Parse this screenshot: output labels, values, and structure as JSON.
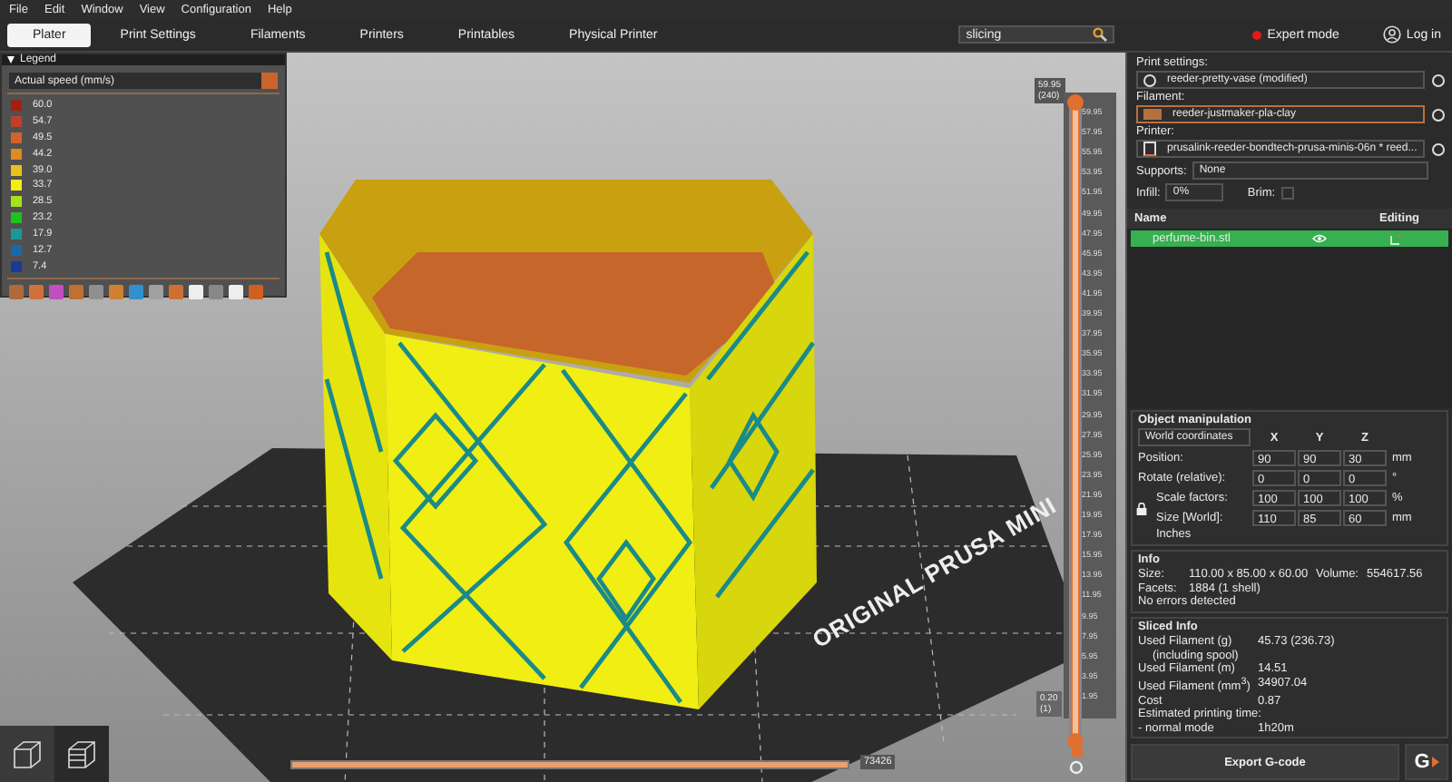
{
  "menu": [
    "File",
    "Edit",
    "Window",
    "View",
    "Configuration",
    "Help"
  ],
  "tabs": [
    {
      "label": "Plater",
      "selected": true
    },
    {
      "label": "Print Settings",
      "selected": false
    },
    {
      "label": "Filaments",
      "selected": false
    },
    {
      "label": "Printers",
      "selected": false
    },
    {
      "label": "Printables",
      "selected": false
    },
    {
      "label": "Physical Printer",
      "selected": false
    }
  ],
  "search": {
    "value": "slicing"
  },
  "mode": {
    "label": "Expert mode"
  },
  "login": {
    "label": "Log in"
  },
  "legend": {
    "title": "Legend",
    "view_type": "Actual speed (mm/s)",
    "items": [
      {
        "label": "60.0",
        "color": "#a3200f"
      },
      {
        "label": "54.7",
        "color": "#c23e2a"
      },
      {
        "label": "49.5",
        "color": "#d4622c"
      },
      {
        "label": "44.2",
        "color": "#e08a20"
      },
      {
        "label": "39.0",
        "color": "#e8c21c"
      },
      {
        "label": "33.7",
        "color": "#f2ee12"
      },
      {
        "label": "28.5",
        "color": "#a6e21a"
      },
      {
        "label": "23.2",
        "color": "#20c020"
      },
      {
        "label": "17.9",
        "color": "#1a9898"
      },
      {
        "label": "12.7",
        "color": "#1a68a6"
      },
      {
        "label": "7.4",
        "color": "#1a3a98"
      }
    ]
  },
  "vertical_slider": {
    "top_value": "59.95",
    "top_layer": "(240)",
    "bottom_value": "0.20",
    "bottom_layer": "(1)",
    "level": 1,
    "ticks": [
      "59.95",
      "57.95",
      "55.95",
      "53.95",
      "51.95",
      "49.95",
      "47.95",
      "45.95",
      "43.95",
      "41.95",
      "39.95",
      "37.95",
      "35.95",
      "33.95",
      "31.95",
      "29.95",
      "27.95",
      "25.95",
      "23.95",
      "21.95",
      "19.95",
      "17.95",
      "15.95",
      "13.95",
      "11.95",
      "9.95",
      "7.95",
      "5.95",
      "3.95",
      "1.95"
    ]
  },
  "horizontal_slider": {
    "value": "73426",
    "level": 1
  },
  "bed_label": "ORIGINAL PRUSA MINI",
  "sidebar": {
    "print_settings": {
      "label": "Print settings:",
      "value": "reeder-pretty-vase (modified)"
    },
    "filament": {
      "label": "Filament:",
      "value": "reeder-justmaker-pla-clay",
      "color": "#b5713c"
    },
    "printer": {
      "label": "Printer:",
      "value": "prusalink-reeder-bondtech-prusa-minis-06n * reed..."
    },
    "supports": {
      "label": "Supports:",
      "value": "None"
    },
    "infill": {
      "label": "Infill:",
      "value": "0%"
    },
    "brim": {
      "label": "Brim:",
      "checked": false
    },
    "object_list": {
      "columns": [
        "Name",
        "Editing"
      ],
      "rows": [
        {
          "name": "perfume-bin.stl",
          "selected": true
        }
      ]
    },
    "manipulation": {
      "title": "Object manipulation",
      "coordinates": "World coordinates",
      "axes": [
        "X",
        "Y",
        "Z"
      ],
      "rows": [
        {
          "label": "Position:",
          "values": [
            "90",
            "90",
            "30"
          ],
          "unit": "mm"
        },
        {
          "label": "Rotate (relative):",
          "values": [
            "0",
            "0",
            "0"
          ],
          "unit": "°"
        },
        {
          "label": "Scale factors:",
          "values": [
            "100",
            "100",
            "100"
          ],
          "unit": "%"
        },
        {
          "label": "Size [World]:",
          "values": [
            "110",
            "85",
            "60"
          ],
          "unit": "mm"
        }
      ],
      "inches": "Inches"
    },
    "info": {
      "title": "Info",
      "size_label": "Size:",
      "size": "110.00 x 85.00 x 60.00",
      "volume_label": "Volume:",
      "volume": "554617.56",
      "facets_label": "Facets:",
      "facets": "1884 (1 shell)",
      "status": "No errors detected"
    },
    "sliced_info": {
      "title": "Sliced Info",
      "rows": [
        {
          "label": "Used Filament (g)",
          "sub": "(including spool)",
          "value": "45.73 (236.73)"
        },
        {
          "label": "Used Filament (m)",
          "value": "14.51"
        },
        {
          "label": "Used Filament (mm$^{3}$)",
          "value": "34907.04"
        },
        {
          "label": "Cost",
          "value": "0.87"
        },
        {
          "label": "Estimated printing time:"
        },
        {
          "label": "- normal mode",
          "value": "1h20m"
        }
      ]
    },
    "export_button": "Export G-code",
    "send_button": "G"
  }
}
